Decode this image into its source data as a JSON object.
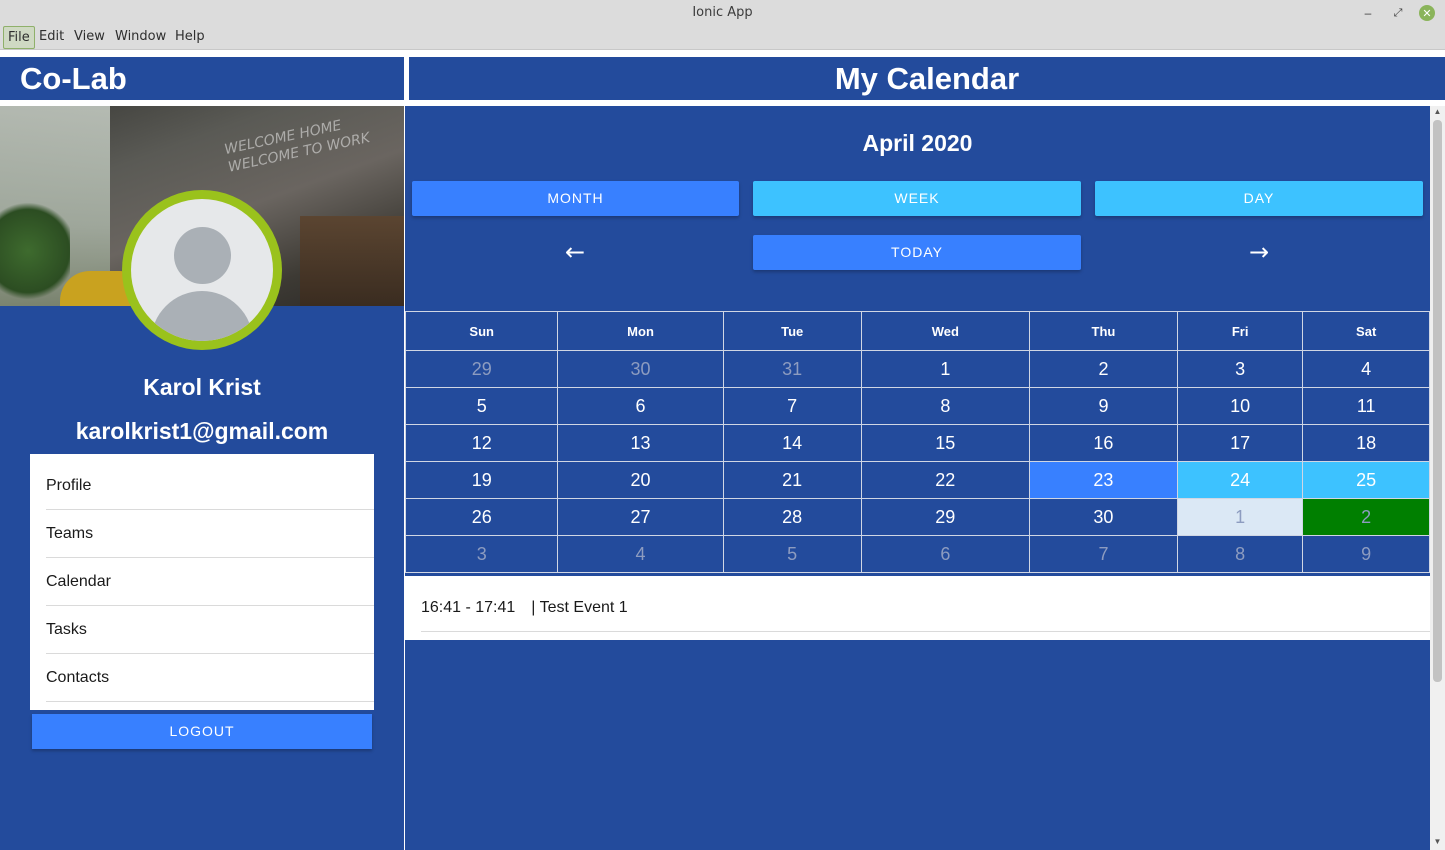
{
  "window": {
    "title": "Ionic App",
    "controls": {
      "minimize": "–",
      "maximize": "⤢",
      "close": "✕"
    }
  },
  "menubar": [
    "File",
    "Edit",
    "View",
    "Window",
    "Help"
  ],
  "sidebar": {
    "app_title": "Co-Lab",
    "user_name": "Karol Krist",
    "user_email": "karolkrist1@gmail.com",
    "nav": [
      "Profile",
      "Teams",
      "Calendar",
      "Tasks",
      "Contacts"
    ],
    "logout_label": "LOGOUT",
    "ring_color": "#9ac21c",
    "bg_color": "#234b9c"
  },
  "main": {
    "page_title": "My Calendar",
    "month_title": "April 2020",
    "buttons": {
      "month": "MONTH",
      "week": "WEEK",
      "day": "DAY",
      "today": "TODAY"
    },
    "arrows": {
      "prev": "←",
      "next": "→"
    },
    "weekdays": [
      "Sun",
      "Mon",
      "Tue",
      "Wed",
      "Thu",
      "Fri",
      "Sat"
    ],
    "weeks": [
      [
        {
          "d": "29",
          "s": "other"
        },
        {
          "d": "30",
          "s": "other"
        },
        {
          "d": "31",
          "s": "other"
        },
        {
          "d": "1",
          "s": ""
        },
        {
          "d": "2",
          "s": ""
        },
        {
          "d": "3",
          "s": ""
        },
        {
          "d": "4",
          "s": ""
        }
      ],
      [
        {
          "d": "5",
          "s": ""
        },
        {
          "d": "6",
          "s": ""
        },
        {
          "d": "7",
          "s": ""
        },
        {
          "d": "8",
          "s": ""
        },
        {
          "d": "9",
          "s": ""
        },
        {
          "d": "10",
          "s": ""
        },
        {
          "d": "11",
          "s": ""
        }
      ],
      [
        {
          "d": "12",
          "s": ""
        },
        {
          "d": "13",
          "s": ""
        },
        {
          "d": "14",
          "s": ""
        },
        {
          "d": "15",
          "s": ""
        },
        {
          "d": "16",
          "s": ""
        },
        {
          "d": "17",
          "s": ""
        },
        {
          "d": "18",
          "s": ""
        }
      ],
      [
        {
          "d": "19",
          "s": ""
        },
        {
          "d": "20",
          "s": ""
        },
        {
          "d": "21",
          "s": ""
        },
        {
          "d": "22",
          "s": ""
        },
        {
          "d": "23",
          "s": "sel"
        },
        {
          "d": "24",
          "s": "hl"
        },
        {
          "d": "25",
          "s": "hl"
        }
      ],
      [
        {
          "d": "26",
          "s": ""
        },
        {
          "d": "27",
          "s": ""
        },
        {
          "d": "28",
          "s": ""
        },
        {
          "d": "29",
          "s": ""
        },
        {
          "d": "30",
          "s": ""
        },
        {
          "d": "1",
          "s": "future-other"
        },
        {
          "d": "2",
          "s": "green"
        }
      ],
      [
        {
          "d": "3",
          "s": "other"
        },
        {
          "d": "4",
          "s": "other"
        },
        {
          "d": "5",
          "s": "other"
        },
        {
          "d": "6",
          "s": "other"
        },
        {
          "d": "7",
          "s": "other"
        },
        {
          "d": "8",
          "s": "other"
        },
        {
          "d": "9",
          "s": "other"
        }
      ]
    ],
    "events": [
      {
        "time": "16:41 - 17:41",
        "title": "| Test Event 1"
      }
    ],
    "colors": {
      "primary": "#3880ff",
      "secondary": "#3dc2ff",
      "selected_green": "#007f00"
    }
  }
}
